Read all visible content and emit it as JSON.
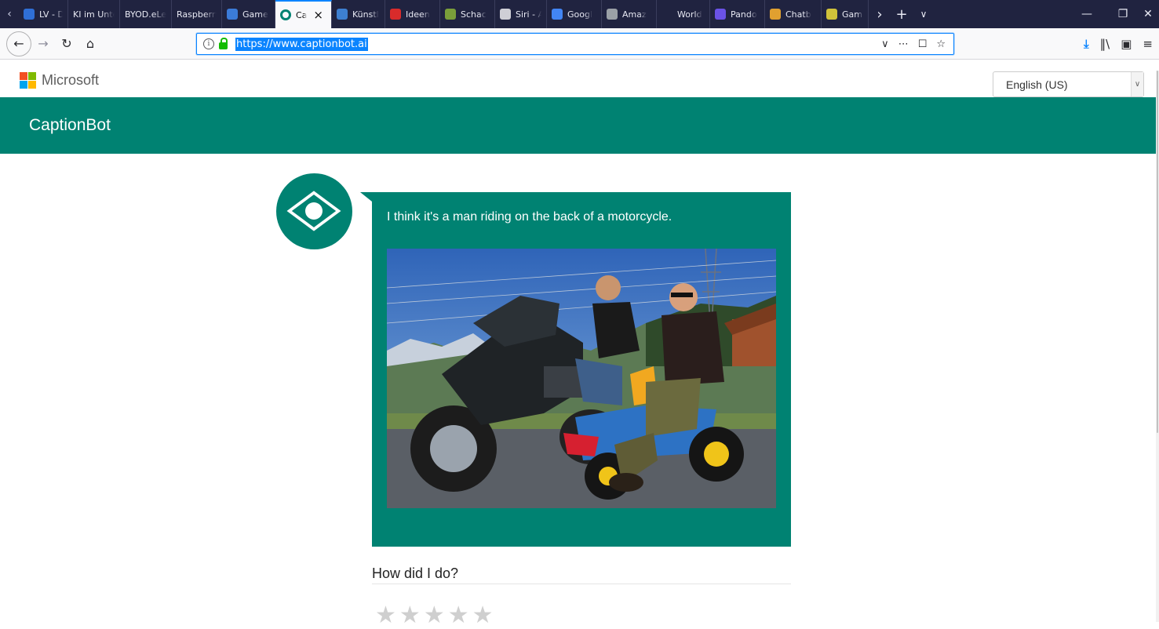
{
  "browser": {
    "tabs": [
      {
        "title": "LV - D",
        "icon": "lv-favicon",
        "color": "#2f6fd6"
      },
      {
        "title": "KI im Unte",
        "icon": "blank-favicon",
        "color": ""
      },
      {
        "title": "BYOD.eLea",
        "icon": "blank-favicon",
        "color": ""
      },
      {
        "title": "Raspberry",
        "icon": "blank-favicon",
        "color": ""
      },
      {
        "title": "Game",
        "icon": "w-favicon",
        "color": "#3b7bd8"
      },
      {
        "title": "Ca",
        "icon": "captionbot-favicon",
        "color": "#008272",
        "active": true
      },
      {
        "title": "Künstl",
        "icon": "image-favicon",
        "color": "#3d7fd1"
      },
      {
        "title": "Ideen",
        "icon": "ideen-favicon",
        "color": "#d92b2b"
      },
      {
        "title": "Schac",
        "icon": "chess-favicon",
        "color": "#7a9e3a"
      },
      {
        "title": "Siri - A",
        "icon": "apple-favicon",
        "color": "#cfcfd6"
      },
      {
        "title": "Googl",
        "icon": "google-favicon",
        "color": "#4285f4"
      },
      {
        "title": "Amaz",
        "icon": "amazon-favicon",
        "color": "#9aa0a6"
      },
      {
        "title": "World",
        "icon": "g-favicon",
        "color": "#e8e9f3"
      },
      {
        "title": "Pando",
        "icon": "pandora-favicon",
        "color": "#6a52e6"
      },
      {
        "title": "Chatb",
        "icon": "chatbot-favicon",
        "color": "#e0a030"
      },
      {
        "title": "Game",
        "icon": "gamer-favicon",
        "color": "#d0c23a"
      }
    ],
    "close_label": "×",
    "url": "https://www.captionbot.ai",
    "info_glyph": "i"
  },
  "page": {
    "brand_word": "Microsoft",
    "language": "English (US)",
    "header_title": "CaptionBot",
    "caption": "I think it's a man riding on the back of a motorcycle.",
    "rate_title": "How did I do?",
    "stars": 5
  },
  "colors": {
    "accent": "#008272",
    "tab_bar": "#202340",
    "url_highlight": "#0a84ff"
  }
}
